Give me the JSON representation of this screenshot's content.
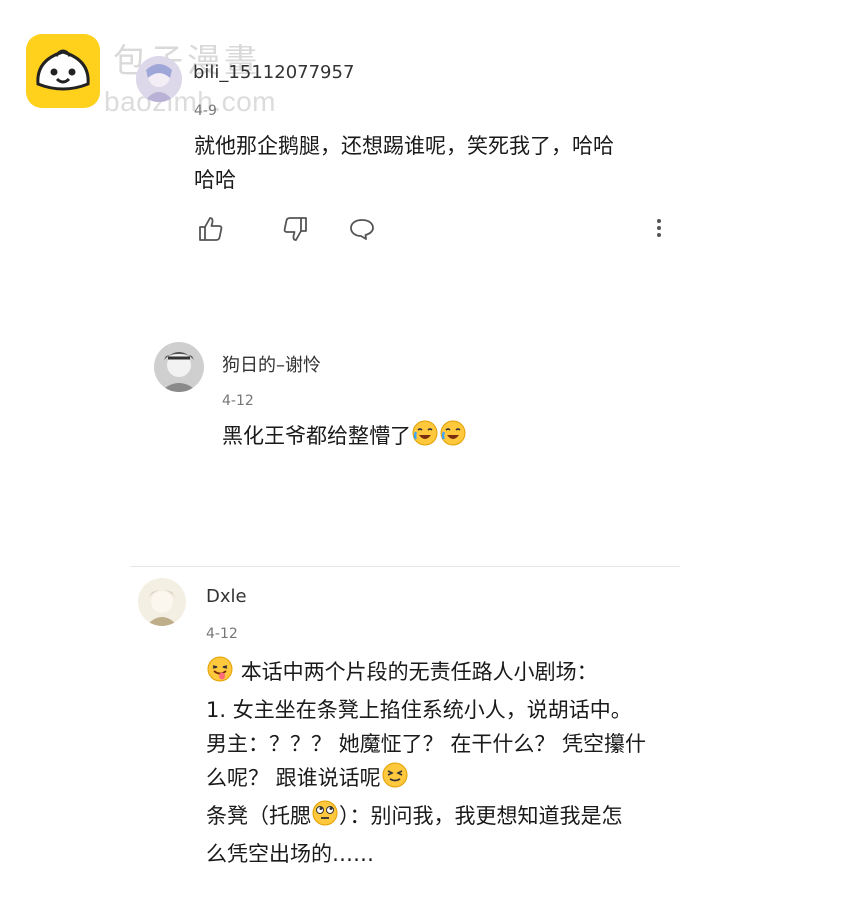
{
  "watermark": {
    "brand_cn": "包子漫畫",
    "url": "baozimh.com"
  },
  "comments": [
    {
      "username": "bili_15112077957",
      "date": "4-9",
      "lines": [
        "就他那企鹅腿，还想踢谁呢，笑死我了，哈哈",
        "哈哈"
      ],
      "actions": {
        "like": "thumbs-up-icon",
        "dislike": "thumbs-down-icon",
        "reply": "speech-bubble-icon",
        "more": "more-vertical-icon"
      }
    },
    {
      "username": "狗日的–谢怜",
      "date": "4-12",
      "text": "黑化王爷都给整懵了",
      "emojis": [
        "crying-laughing-emoji",
        "crying-laughing-emoji"
      ]
    },
    {
      "username": "Dxle",
      "date": "4-12",
      "line1": "本话中两个片段的无责任路人小剧场：",
      "line2": "1.  女主坐在条凳上掐住系统小人，说胡话中。",
      "line3": "男主：？？？ 她魔怔了？ 在干什么？ 凭空攥什",
      "line4": "么呢？ 跟谁说话呢",
      "line5a": "条凳（托腮",
      "line5b": "）：别问我，我更想知道我是怎",
      "line6": "么凭空出场的……",
      "emojis": [
        "tongue-out-emoji",
        "squinting-face-emoji",
        "eye-roll-emoji"
      ]
    }
  ],
  "colors": {
    "logo_bg": "#ffd11c",
    "text": "#1a1a1a",
    "meta": "#777777",
    "icon": "#555555",
    "emoji_yellow": "#ffc83d"
  }
}
